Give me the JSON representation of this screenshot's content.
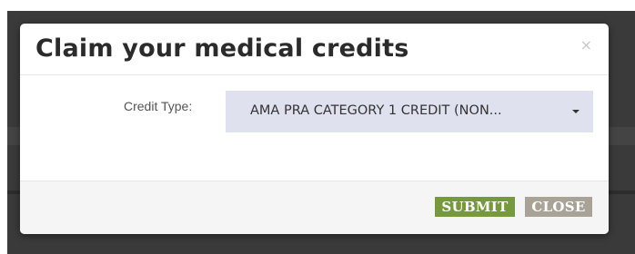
{
  "modal": {
    "title": "Claim your medical credits",
    "close_glyph": "×",
    "close_icon": "close-icon"
  },
  "form": {
    "credit_type_label": "Credit Type:",
    "credit_type_value": "AMA PRA CATEGORY 1 CREDIT (NON...",
    "dropdown_icon": "caret-down-icon"
  },
  "footer": {
    "submit_label": "SUBMIT",
    "close_label": "CLOSE"
  },
  "colors": {
    "submit_button": "#76993b",
    "close_button": "#a8a396",
    "select_background": "#dfe1ee",
    "title_text": "#2b2b2b"
  }
}
